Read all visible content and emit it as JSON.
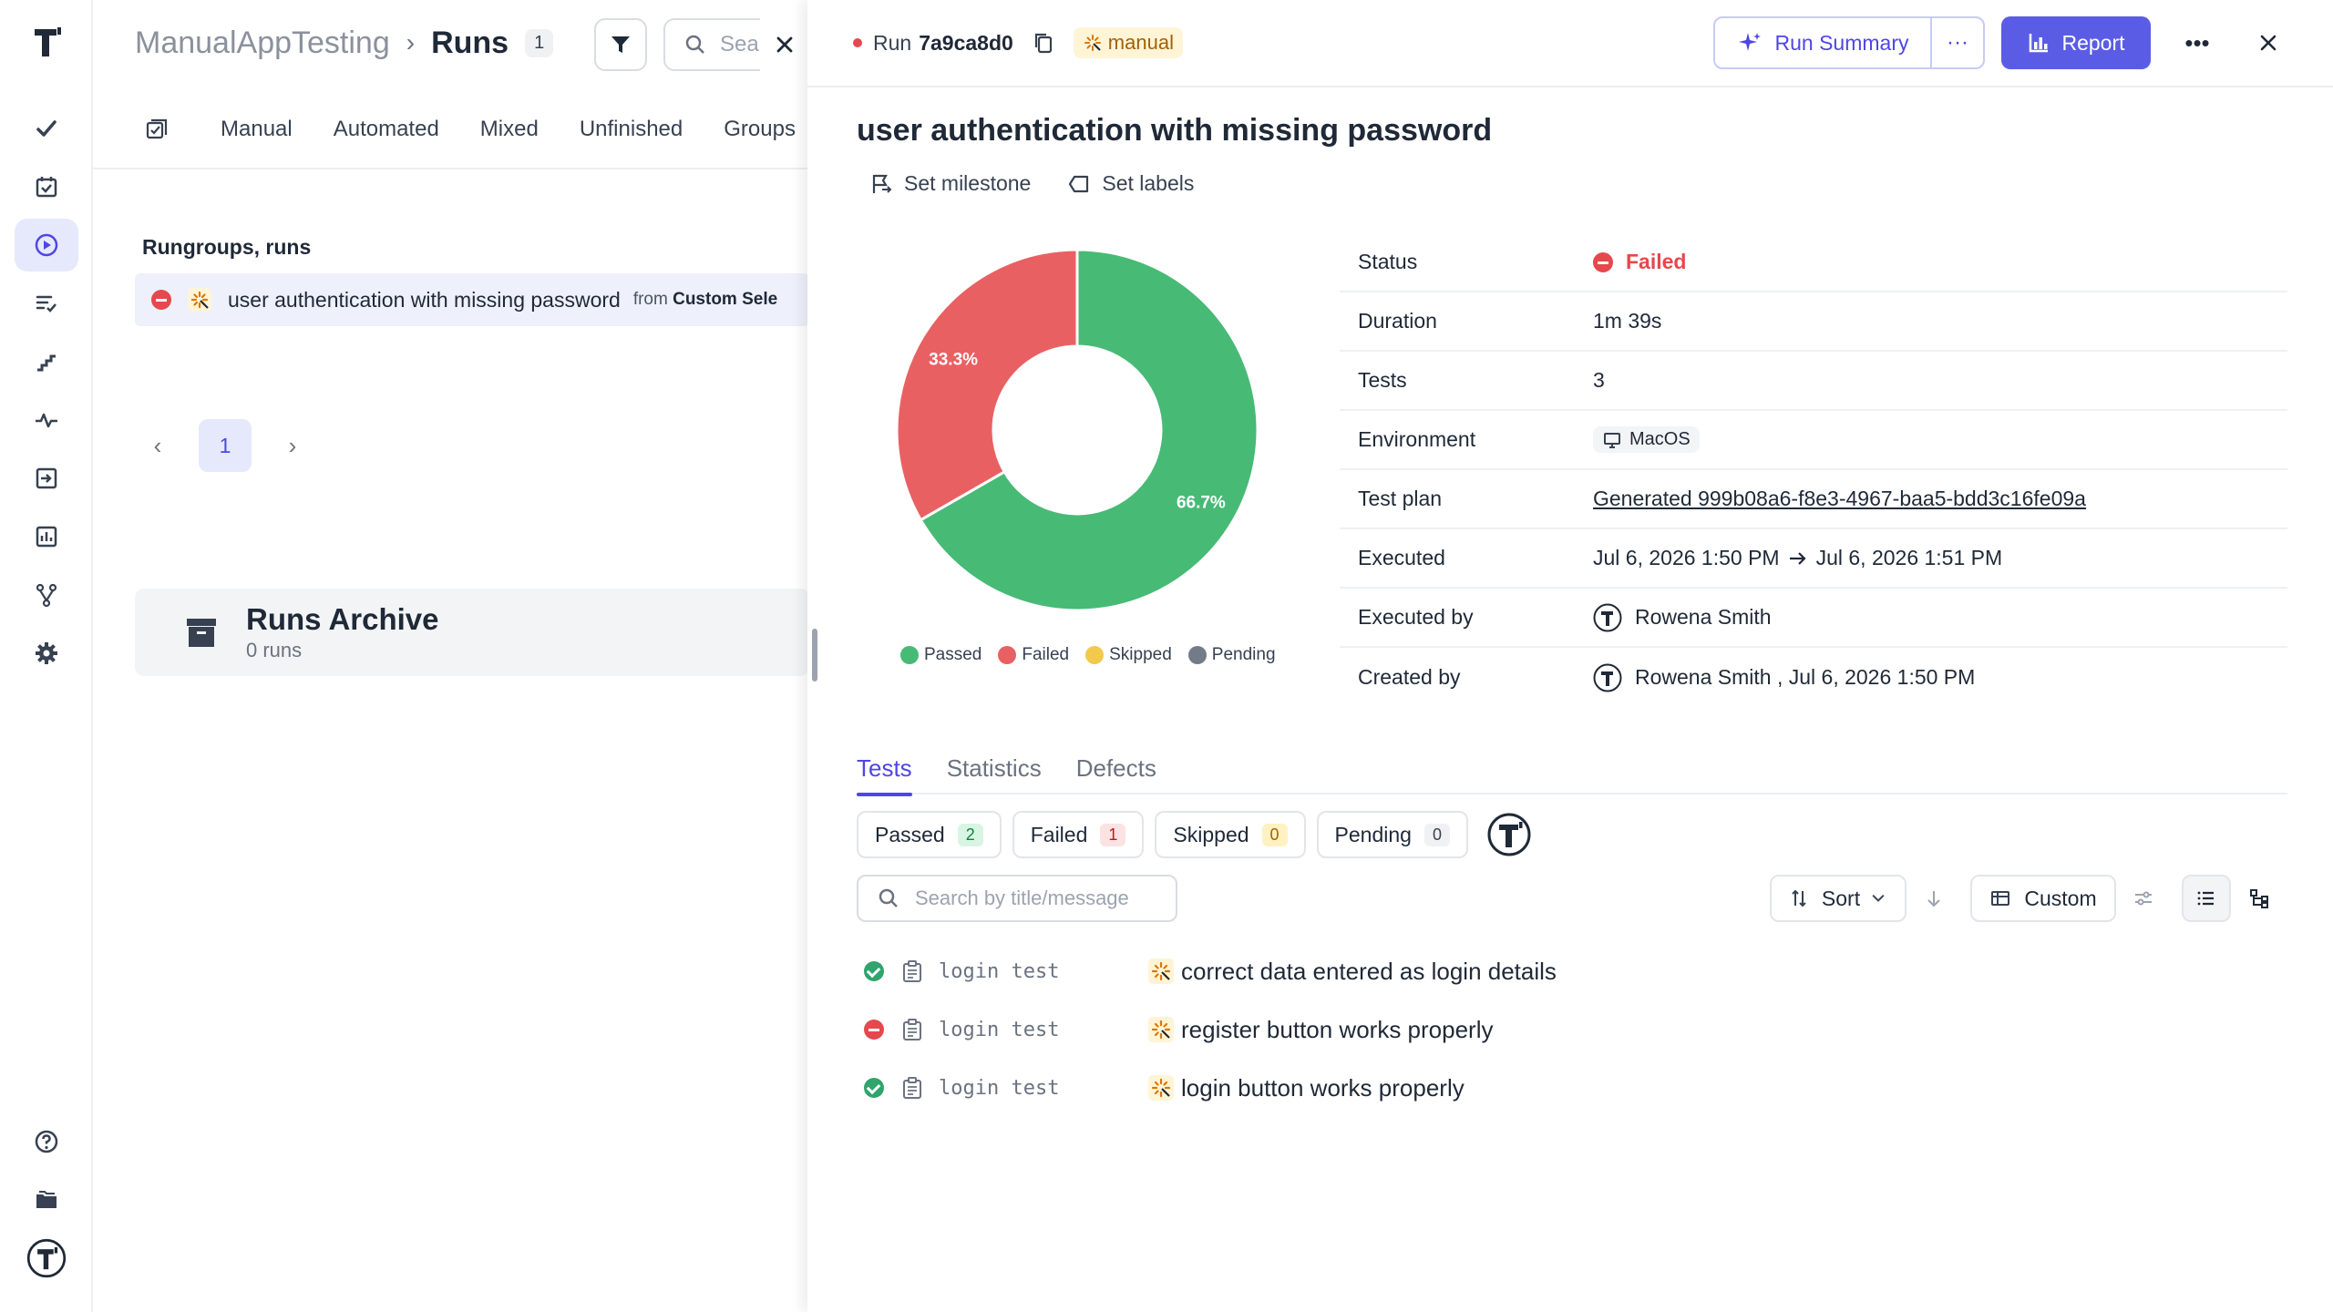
{
  "breadcrumb": {
    "project": "ManualAppTesting",
    "separator": "›",
    "current": "Runs",
    "count": "1"
  },
  "left_search": {
    "placeholder": "Sea"
  },
  "left_tabs": [
    "Manual",
    "Automated",
    "Mixed",
    "Unfinished",
    "Groups"
  ],
  "section_title": "Rungroups, runs",
  "run_row": {
    "title": "user authentication with missing password",
    "from_label": "from",
    "from_value": "Custom Sele"
  },
  "pager": {
    "current_page": "1"
  },
  "archive": {
    "title": "Runs Archive",
    "count": "0 runs"
  },
  "run": {
    "label": "Run",
    "id": "7a9ca8d0",
    "type_tag": "manual",
    "title": "user authentication with missing password",
    "actions": {
      "milestone": "Set milestone",
      "labels": "Set labels"
    },
    "buttons": {
      "summary": "Run Summary",
      "report": "Report",
      "more": "···"
    }
  },
  "chart_data": {
    "type": "pie",
    "donut": true,
    "categories": [
      "Passed",
      "Failed",
      "Skipped",
      "Pending"
    ],
    "values": [
      66.7,
      33.3,
      0,
      0
    ],
    "value_labels": [
      "66.7%",
      "33.3%",
      "",
      ""
    ],
    "colors": [
      "#47ba76",
      "#e96063",
      "#f2c94c",
      "#737b88"
    ],
    "legend_position": "bottom"
  },
  "details": [
    {
      "label": "Status",
      "value": "Failed"
    },
    {
      "label": "Duration",
      "value": "1m 39s"
    },
    {
      "label": "Tests",
      "value": "3"
    },
    {
      "label": "Environment",
      "value": "MacOS"
    },
    {
      "label": "Test plan",
      "value": "Generated 999b08a6-f8e3-4967-baa5-bdd3c16fe09a"
    },
    {
      "label": "Executed",
      "value_start": "Jul 6, 2026 1:50 PM",
      "value_end": "Jul 6, 2026 1:51 PM"
    },
    {
      "label": "Executed by",
      "value": "Rowena Smith"
    },
    {
      "label": "Created by",
      "value": "Rowena Smith , Jul 6, 2026 1:50 PM"
    }
  ],
  "bottom_tabs": [
    "Tests",
    "Statistics",
    "Defects"
  ],
  "filter_chips": [
    {
      "label": "Passed",
      "count": "2"
    },
    {
      "label": "Failed",
      "count": "1"
    },
    {
      "label": "Skipped",
      "count": "0"
    },
    {
      "label": "Pending",
      "count": "0"
    }
  ],
  "test_search": {
    "placeholder": "Search by title/message"
  },
  "toolbar": {
    "sort": "Sort",
    "custom": "Custom"
  },
  "tests": [
    {
      "status": "passed",
      "suite": "login test",
      "title": "correct data entered as login details"
    },
    {
      "status": "failed",
      "suite": "login test",
      "title": "register button works properly"
    },
    {
      "status": "passed",
      "suite": "login test",
      "title": "login button works properly"
    }
  ],
  "colors": {
    "accent": "#4f46e5",
    "passed": "#30a46c",
    "failed": "#e5484d"
  }
}
